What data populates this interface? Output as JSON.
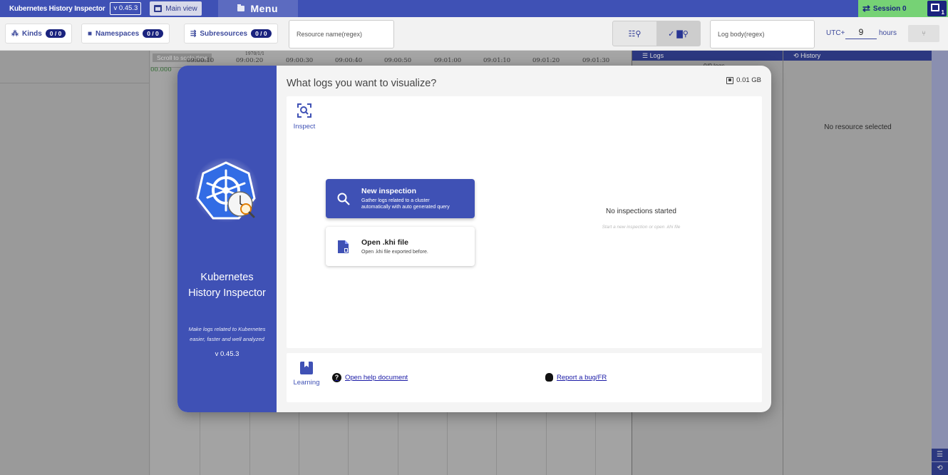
{
  "topbar": {
    "app_title": "Kubernetes History Inspector",
    "version": "v 0.45.3",
    "main_view_label": "Main view",
    "menu_label": "Menu",
    "session_label": "Session 0",
    "session_count": "1"
  },
  "filters": {
    "kinds_label": "Kinds",
    "kinds_count": "0 / 0",
    "namespaces_label": "Namespaces",
    "namespaces_count": "0 / 0",
    "subresources_label": "Subresources",
    "subresources_count": "0 / 0",
    "resource_name_placeholder": "Resource name(regex)",
    "log_body_placeholder": "Log body(regex)",
    "utc_label": "UTC+",
    "utc_offset": "9",
    "hours_label": "hours"
  },
  "timeline": {
    "scroll_hint": "Scroll to scale time",
    "zero_time": "00.000",
    "date_label": "1970/1/1",
    "ticks": [
      "09:00:10",
      "09:00:20",
      "09:00:30",
      "09:00:40",
      "09:00:50",
      "09:01:00",
      "09:01:10",
      "09:01:20",
      "09:01:30"
    ]
  },
  "logs_pane": {
    "tab_label": "Logs",
    "count": "0/0 logs"
  },
  "history_pane": {
    "tab_label": "History",
    "empty_text": "No resource selected"
  },
  "modal": {
    "side": {
      "app_name_line1": "Kubernetes",
      "app_name_line2": "History Inspector",
      "description_line1": "Make logs related to Kubernetes",
      "description_line2": "easier, faster and well analyzed",
      "version": "v 0.45.3"
    },
    "title": "What logs you want to visualize?",
    "storage": "0.01 GB",
    "inspect_tab_label": "Inspect",
    "new_inspection": {
      "title": "New inspection",
      "desc_line1": "Gather logs related to a cluster",
      "desc_line2": "automatically with auto generated query"
    },
    "open_file": {
      "title": "Open .khi file",
      "desc": "Open .khi file exported before."
    },
    "empty_title": "No inspections started",
    "empty_sub": "Start a new inspection or open .khi file",
    "learning_label": "Learning",
    "help_link": "Open help document",
    "bug_link": "Report a bug/FR"
  },
  "colors": {
    "primary": "#3f51b5",
    "session_green": "#76d275",
    "dark_navy": "#1a237e"
  },
  "icons": [
    "kinds-icon",
    "folder-icon",
    "subresource-icon",
    "check-icon",
    "search-icon",
    "file-icon",
    "book-icon",
    "help-icon",
    "bug-icon",
    "history-icon",
    "logs-icon",
    "chip-icon",
    "swap-icon"
  ]
}
